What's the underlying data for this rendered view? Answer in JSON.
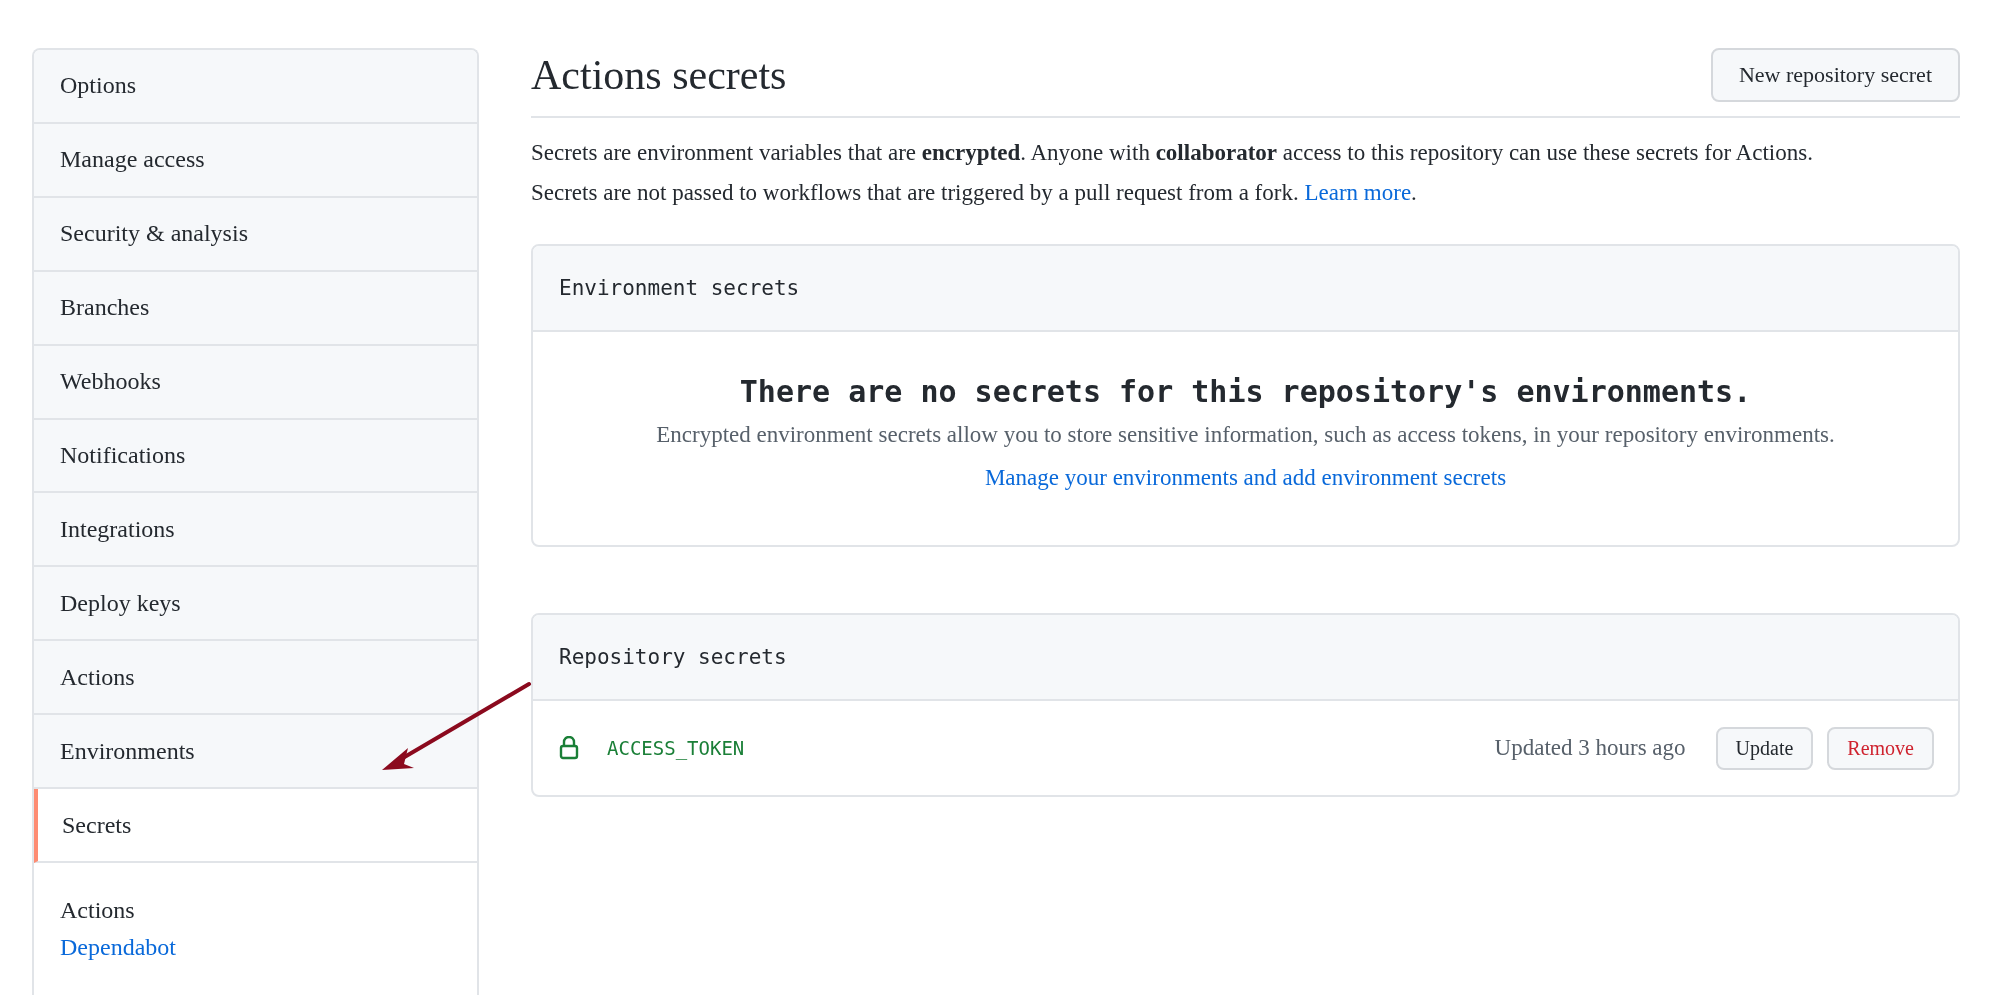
{
  "sidebar": {
    "items": [
      {
        "label": "Options",
        "selected": false
      },
      {
        "label": "Manage access",
        "selected": false
      },
      {
        "label": "Security & analysis",
        "selected": false
      },
      {
        "label": "Branches",
        "selected": false
      },
      {
        "label": "Webhooks",
        "selected": false
      },
      {
        "label": "Notifications",
        "selected": false
      },
      {
        "label": "Integrations",
        "selected": false
      },
      {
        "label": "Deploy keys",
        "selected": false
      },
      {
        "label": "Actions",
        "selected": false
      },
      {
        "label": "Environments",
        "selected": false
      },
      {
        "label": "Secrets",
        "selected": true
      }
    ],
    "subsection": {
      "heading": "Actions",
      "links": [
        "Dependabot"
      ]
    }
  },
  "header": {
    "title": "Actions secrets",
    "button": "New repository secret"
  },
  "description": [
    "Secrets are environment variables that are **encrypted**. Anyone with **collaborator** access to this repository can use these secrets for Actions."
  ],
  "note": {
    "text": "Secrets are not passed to workflows that are triggered by a pull request from a fork.",
    "link": "Learn more",
    "trailing": "."
  },
  "environment_secrets": {
    "title": "Environment secrets",
    "empty_title": "There are no secrets for this repository's environments.",
    "empty_text": "Encrypted environment secrets allow you to store sensitive information, such as access tokens, in your repository environments.",
    "link": "Manage your environments and add environment secrets"
  },
  "repository_secrets": {
    "title": "Repository secrets",
    "rows": [
      {
        "name": "ACCESS_TOKEN",
        "updated": "Updated 3 hours ago",
        "actions": [
          {
            "label": "Update",
            "kind": "default"
          },
          {
            "label": "Remove",
            "kind": "danger"
          }
        ]
      }
    ]
  }
}
